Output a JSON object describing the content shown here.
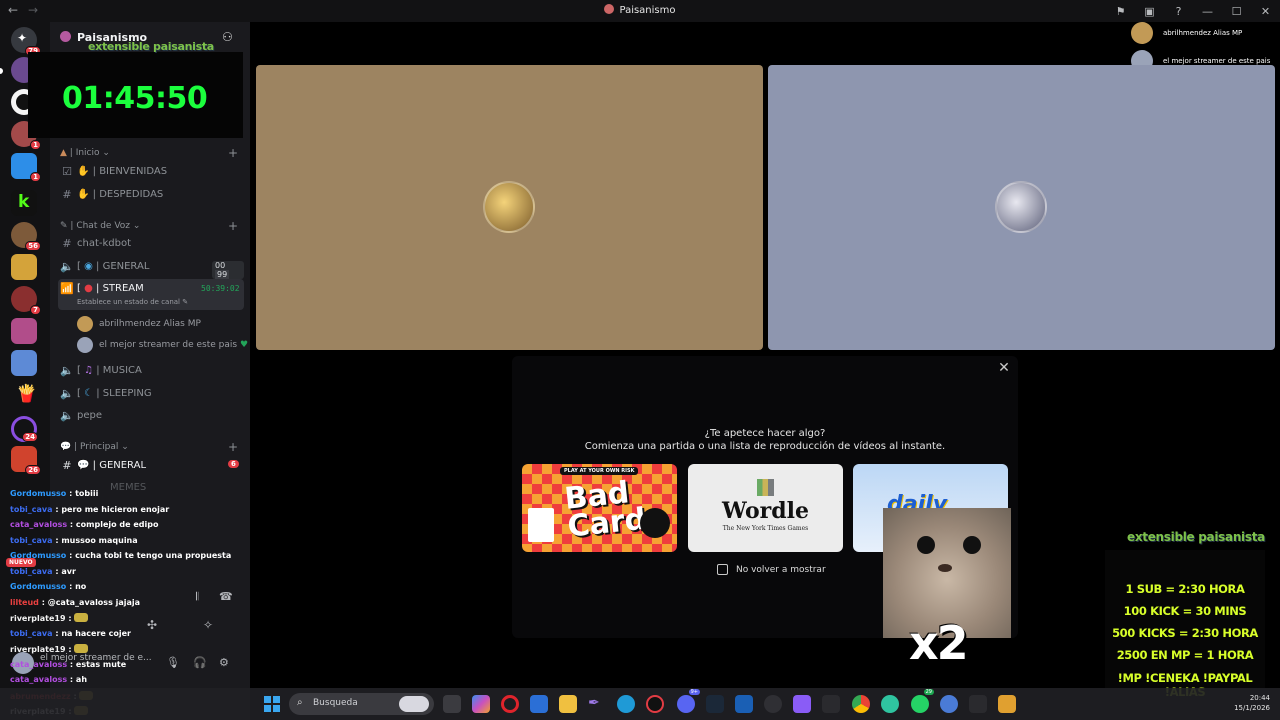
{
  "window": {
    "title": "Paisanismo"
  },
  "rail": {
    "badges": [
      "79",
      "1",
      "1",
      "56",
      "7",
      "24",
      "26"
    ]
  },
  "sidebar": {
    "guild_name": "Paisanismo",
    "categories": {
      "inicio": "| Inicio",
      "voz": "| Chat de Voz",
      "principal": "| Principal"
    },
    "channels": {
      "bienvenidas": "| BIENVENIDAS",
      "despedidas": "| DESPEDIDAS",
      "kdbot": "chat-kdbot",
      "general_voice": "| GENERAL",
      "general_voice_count": "00",
      "general_voice_limit": "99",
      "stream": "| STREAM",
      "stream_time": "50:39:02",
      "stream_status": "Establece un estado de canal",
      "musica": "| MUSICA",
      "sleeping": "| SLEEPING",
      "pepe": "pepe",
      "general_text": "| GENERAL",
      "general_text_badge": "6",
      "memes": "MEMES"
    },
    "members": [
      {
        "name": "abrilhmendez Alias MP"
      },
      {
        "name": "el mejor streamer de este pais"
      }
    ]
  },
  "overlay": {
    "logo_top": "extensible paisanista",
    "timer": "01:45:50",
    "rules_logo": "extensible paisanista",
    "rules": [
      "1 SUB = 2:30 HORA",
      "100 KICK = 30 MINS",
      "500 KICKS = 2:30 HORA",
      "2500 EN MP = 1 HORA",
      "!MP !CENEKA !PAYPAL !ALIAS"
    ],
    "cat_multiplier": "x2"
  },
  "stage": {
    "participants": [
      {
        "name": "abrilhmendez Alias MP",
        "tile_color": "#9d8461"
      },
      {
        "name": "el mejor streamer de este pais",
        "tile_color": "#8e96af"
      }
    ],
    "modal": {
      "title": "¿Te apetece hacer algo?",
      "subtitle": "Comienza una partida o una lista de reproducción de vídeos al instante.",
      "cards": [
        {
          "name": "Bad Cards",
          "header": "PLAY AT YOUR OWN RISK",
          "title": "Bad Cards"
        },
        {
          "name": "Wordle",
          "title": "Wordle",
          "subtitle": "The New York Times Games"
        },
        {
          "name": "Daily Sudoku",
          "title": "daily SUDOKU"
        }
      ],
      "checkbox_label": "No volver a mostrar"
    }
  },
  "chat": {
    "new_label": "NUEVO",
    "lines": [
      {
        "user": "Gordomusso",
        "msg": "tobiii",
        "color": "#2e9bff"
      },
      {
        "user": "tobi_cava",
        "msg": "pero me hicieron enojar",
        "color": "#3c6cf0"
      },
      {
        "user": "cata_avaloss",
        "msg": "complejo de edipo",
        "color": "#b24ee0"
      },
      {
        "user": "tobi_cava",
        "msg": "mussoo maquina",
        "color": "#3c6cf0"
      },
      {
        "user": "Gordomusso",
        "msg": "cucha tobi te tengo una propuesta",
        "color": "#2e9bff"
      },
      {
        "user": "tobi_cava",
        "msg": "avr",
        "color": "#3c6cf0"
      },
      {
        "user": "Gordomusso",
        "msg": "no",
        "color": "#2e9bff"
      },
      {
        "user": "lilteud",
        "msg": "@cata_avaloss jajaja",
        "color": "#e94040"
      },
      {
        "user": "riverplate19",
        "msg": "",
        "color": "#f2f2f2"
      },
      {
        "user": "tobi_cava",
        "msg": "na hacere cojer",
        "color": "#3c6cf0"
      },
      {
        "user": "riverplate19",
        "msg": "",
        "color": "#f2f2f2"
      },
      {
        "user": "cata_avaloss",
        "msg": "estas mute",
        "color": "#b24ee0"
      },
      {
        "user": "cata_avaloss",
        "msg": "ah",
        "color": "#b24ee0"
      },
      {
        "user": "abrumendezz",
        "msg": "",
        "color": "#e94040"
      },
      {
        "user": "riverplate19",
        "msg": "",
        "color": "#f2f2f2"
      }
    ]
  },
  "userpanel": {
    "name": "el mejor streamer de e..."
  },
  "taskbar": {
    "search_placeholder": "Busqueda",
    "time": "20:44",
    "date": "15/1/2026",
    "badges": {
      "discord": "9+",
      "whatsapp": "29"
    }
  }
}
